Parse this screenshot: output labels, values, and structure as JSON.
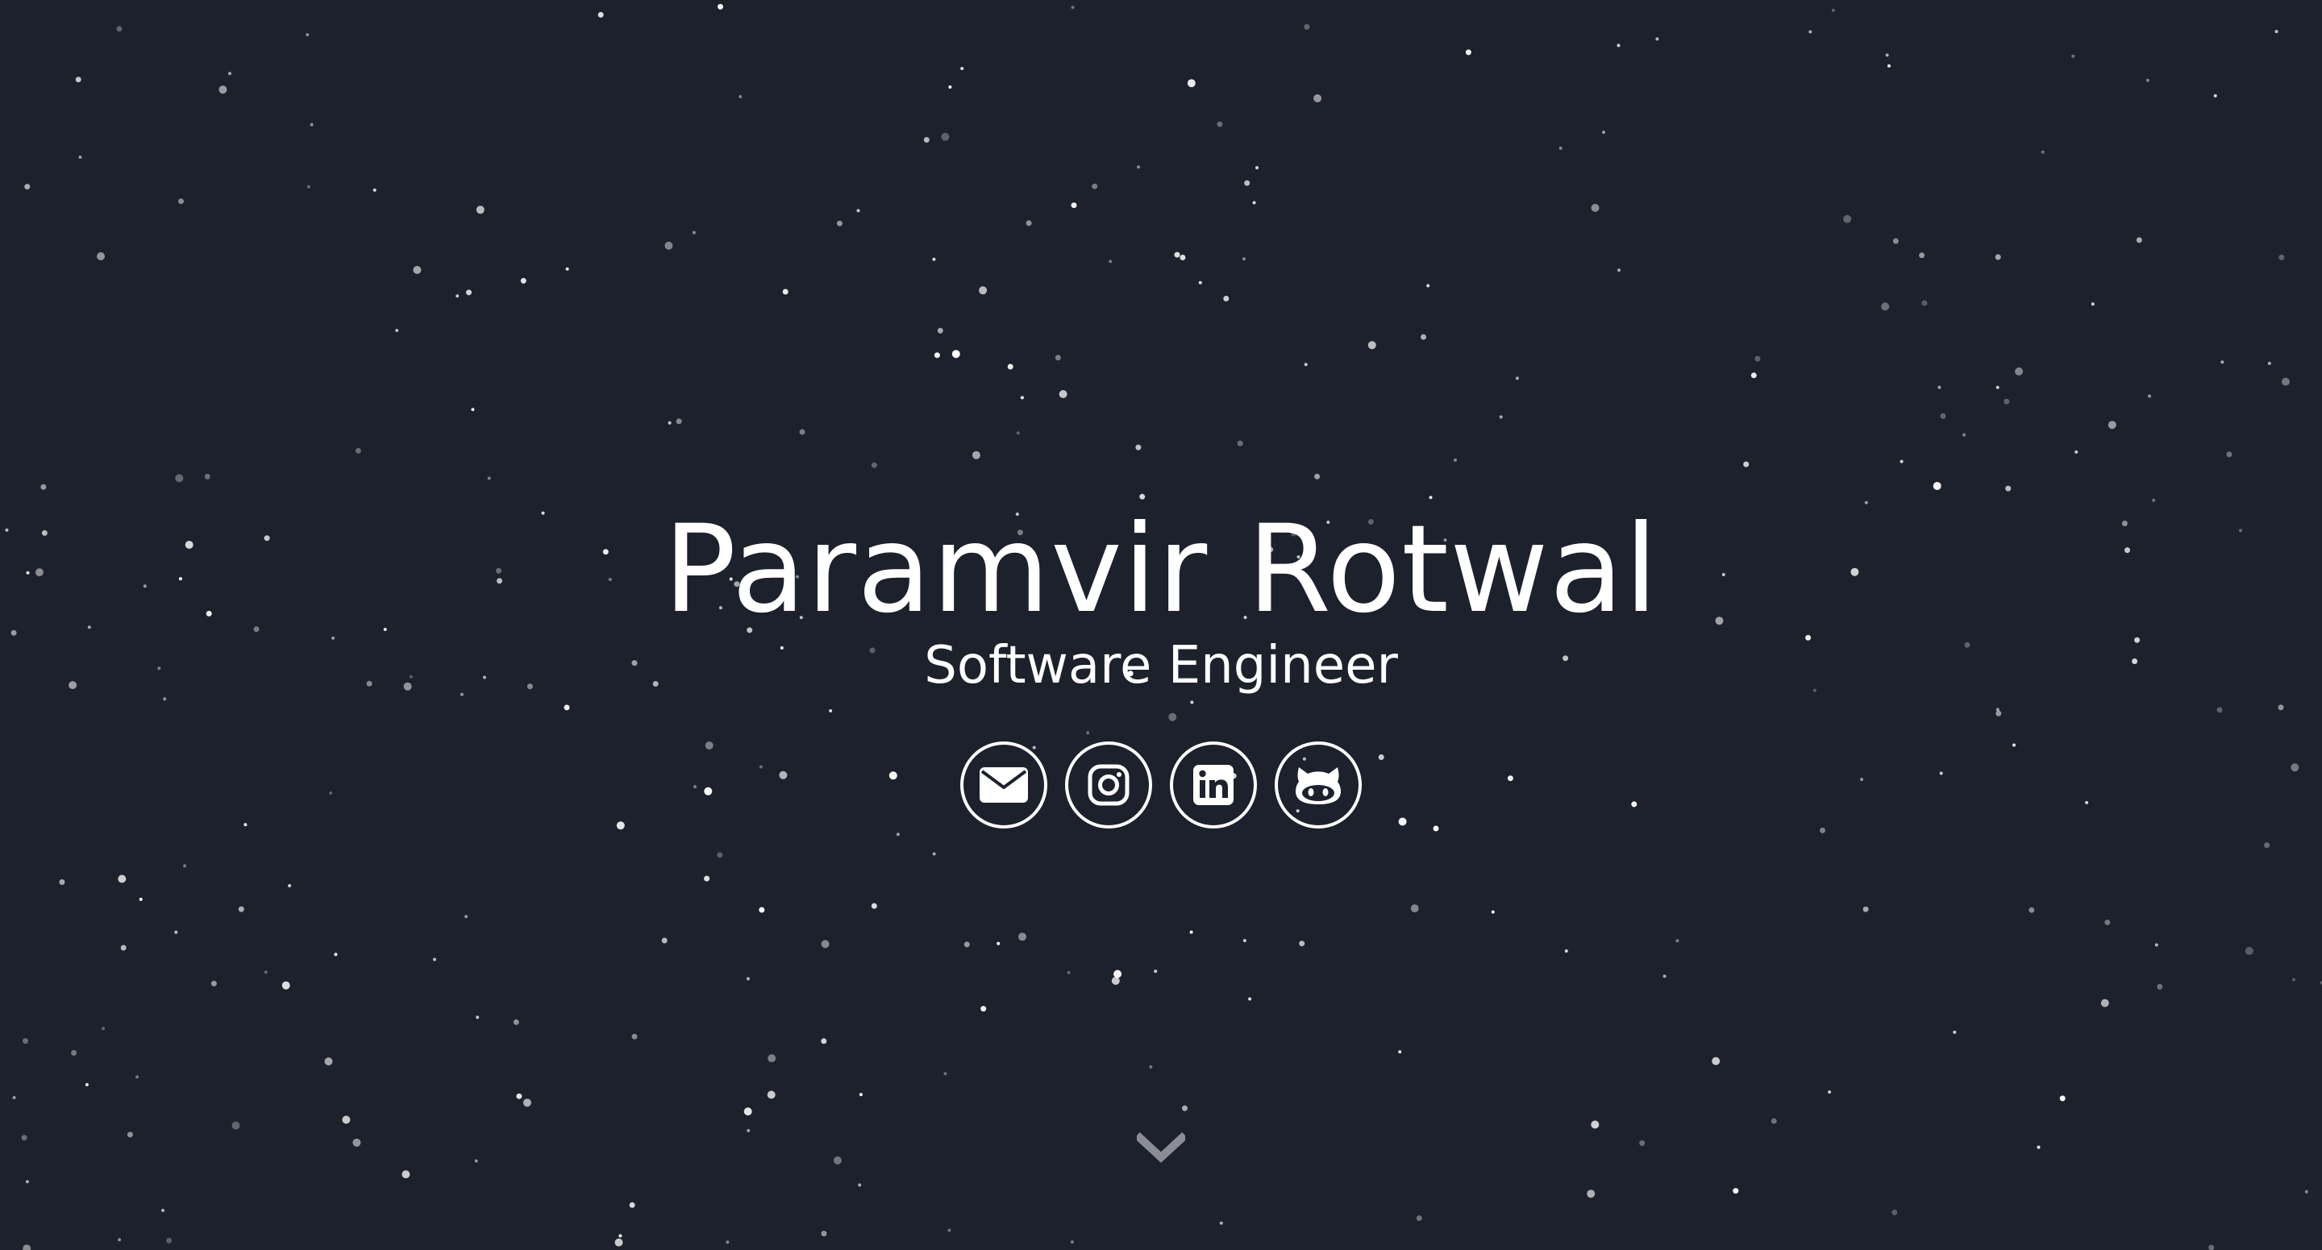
{
  "hero": {
    "name": "Paramvir Rotwal",
    "title": "Software Engineer"
  },
  "socials": [
    {
      "icon": "mail-icon",
      "label": "Email"
    },
    {
      "icon": "instagram-icon",
      "label": "Instagram"
    },
    {
      "icon": "linkedin-icon",
      "label": "LinkedIn"
    },
    {
      "icon": "github-icon",
      "label": "GitHub"
    }
  ],
  "scroll": {
    "icon": "chevron-down-icon"
  },
  "colors": {
    "background": "#1d212c",
    "text": "#ffffff",
    "star": "#ffffff",
    "chevron": "#8a8d94"
  }
}
